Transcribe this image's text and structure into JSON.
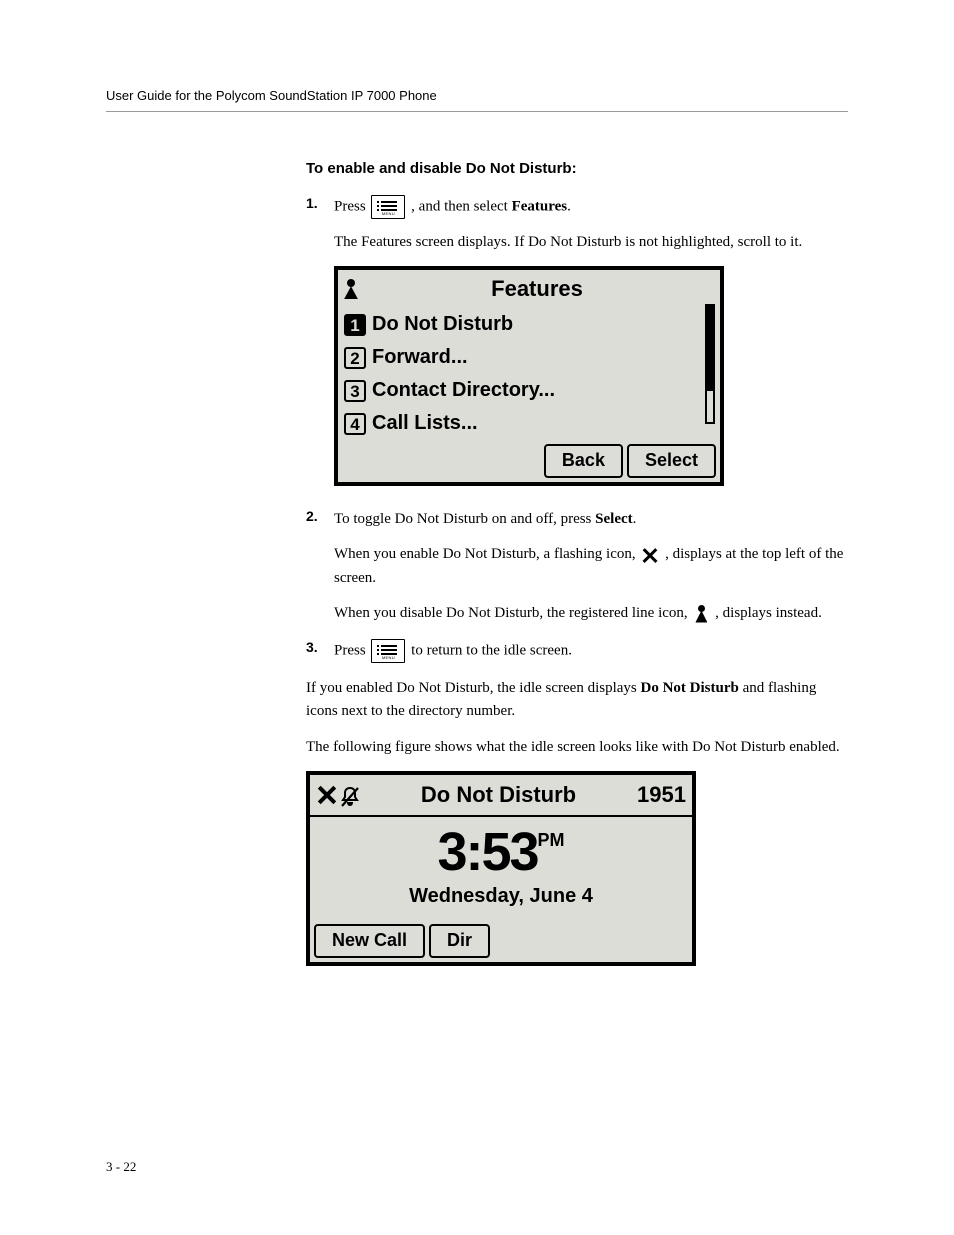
{
  "header": "User Guide for the Polycom SoundStation IP 7000 Phone",
  "section_heading": "To enable and disable Do Not Disturb:",
  "steps": {
    "s1": {
      "num": "1.",
      "p1_a": "Press ",
      "p1_b": " , and then select ",
      "p1_bold": "Features",
      "p1_c": ".",
      "p2": "The Features screen displays. If Do Not Disturb is not highlighted, scroll to it."
    },
    "s2": {
      "num": "2.",
      "p1_a": "To toggle Do Not Disturb on and off, press ",
      "p1_bold": "Select",
      "p1_b": ".",
      "p2_a": "When you enable Do Not Disturb, a flashing icon, ",
      "p2_b": " , displays at the top left of the screen.",
      "p3_a": "When you disable Do Not Disturb, the registered line icon, ",
      "p3_b": " , displays instead."
    },
    "s3": {
      "num": "3.",
      "p1_a": "Press ",
      "p1_b": " to return to the idle screen."
    }
  },
  "after_steps": {
    "p1_a": "If you enabled Do Not Disturb, the idle screen displays ",
    "p1_bold": "Do Not Disturb",
    "p1_b": " and flashing icons next to the directory number.",
    "p2": "The following figure shows what the idle screen looks like with Do Not Disturb enabled."
  },
  "lcd1": {
    "title": "Features",
    "items": [
      {
        "n": "1",
        "label": "Do Not Disturb",
        "sel": true
      },
      {
        "n": "2",
        "label": "Forward...",
        "sel": false
      },
      {
        "n": "3",
        "label": "Contact Directory...",
        "sel": false
      },
      {
        "n": "4",
        "label": "Call Lists...",
        "sel": false
      }
    ],
    "softkeys": [
      "Back",
      "Select"
    ]
  },
  "lcd2": {
    "title": "Do Not Disturb",
    "ext": "1951",
    "time": "3:53",
    "ampm": "PM",
    "date": "Wednesday, June 4",
    "softkeys": [
      "New Call",
      "Dir"
    ]
  },
  "page_num": "3 - 22"
}
